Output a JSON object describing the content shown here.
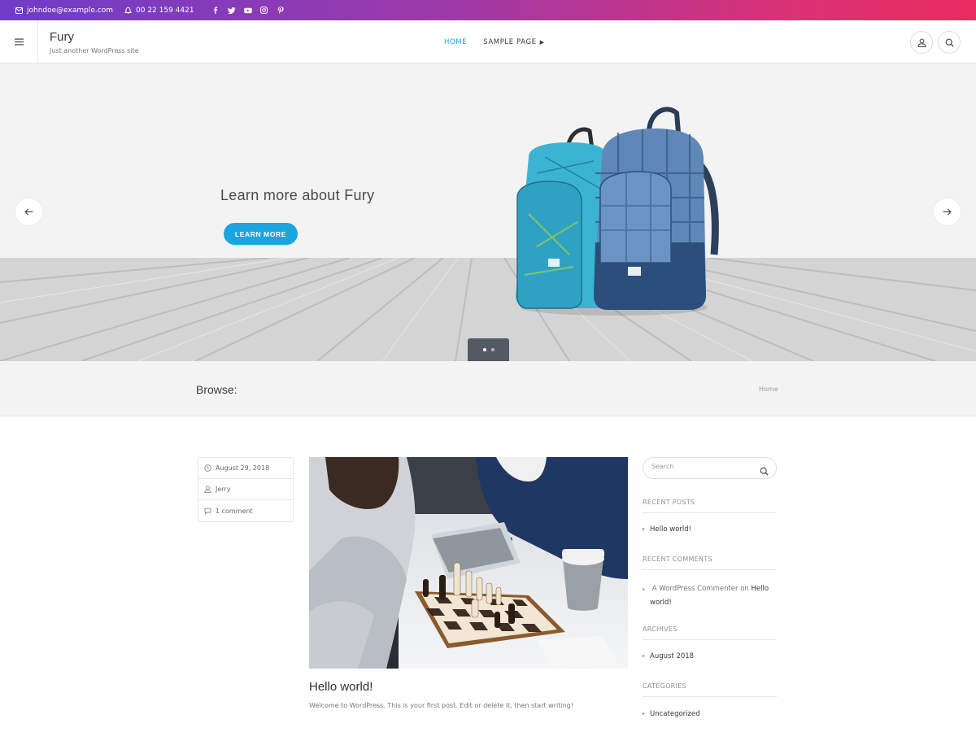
{
  "topbar": {
    "email": "johndoe@example.com",
    "phone": "00 22 159 4421",
    "social_icons": [
      "facebook-icon",
      "twitter-icon",
      "youtube-icon",
      "instagram-icon",
      "pinterest-icon"
    ]
  },
  "header": {
    "site_title": "Fury",
    "site_description": "Just another WordPress site",
    "nav": [
      {
        "label": "HOME",
        "active": true
      },
      {
        "label": "SAMPLE PAGE",
        "active": false,
        "has_submenu": true
      }
    ]
  },
  "hero": {
    "title": "Learn more about Fury",
    "button_label": "LEARN MORE",
    "slides": 2,
    "active_slide": 1
  },
  "browse": {
    "label": "Browse:",
    "breadcrumb": "Home"
  },
  "post": {
    "date": "August 29, 2018",
    "author": "Jerry",
    "comments": "1 comment",
    "title": "Hello world!",
    "excerpt": "Welcome to WordPress. This is your first post. Edit or delete it, then start writing!"
  },
  "sidebar": {
    "search_placeholder": "Search",
    "recent_posts_title": "RECENT POSTS",
    "recent_posts": [
      "Hello world!"
    ],
    "recent_comments_title": "RECENT COMMENTS",
    "recent_comment": {
      "author": "A WordPress Commenter",
      "on": "on",
      "post_line1": "Hello",
      "post_line2": "world!"
    },
    "archives_title": "ARCHIVES",
    "archives": [
      "August 2018"
    ],
    "categories_title": "CATEGORIES",
    "categories": [
      "Uncategorized"
    ]
  },
  "colors": {
    "accent": "#1aa5e0",
    "gradient_start": "#6f3cc8",
    "gradient_end": "#ea2c5f"
  }
}
